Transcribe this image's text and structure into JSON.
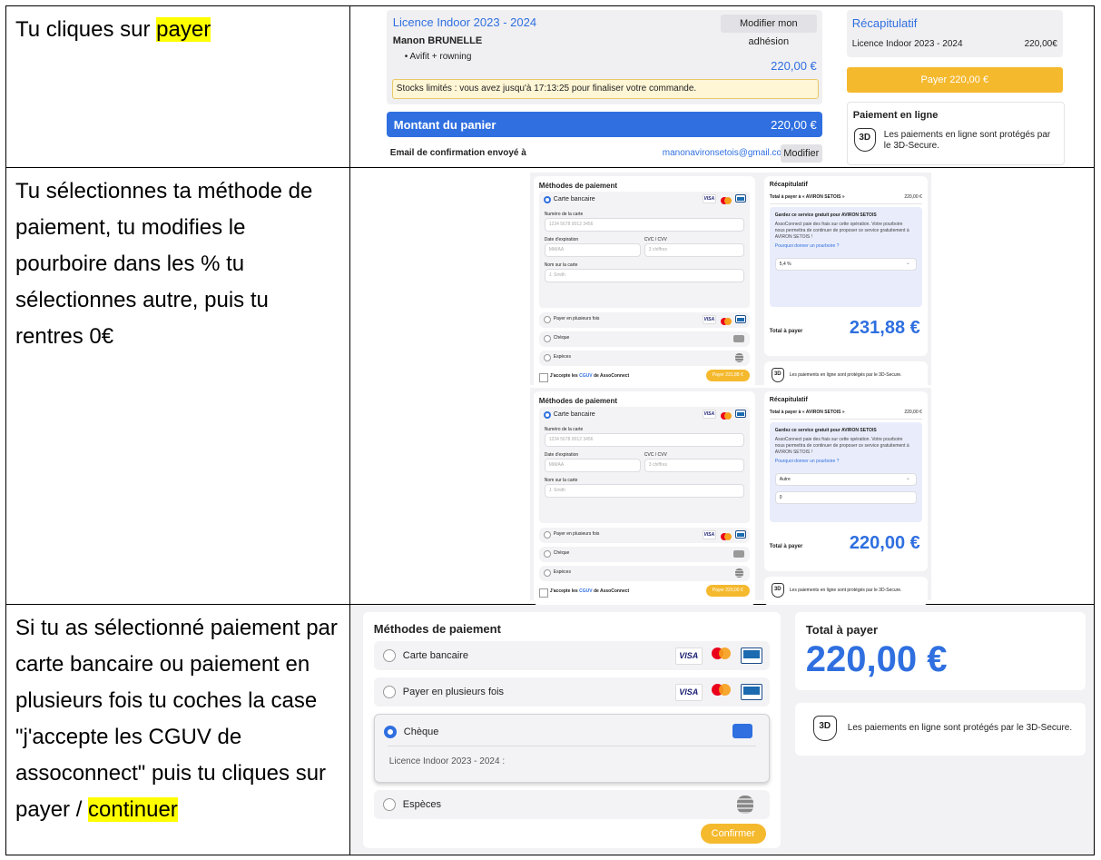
{
  "rows": [
    {
      "text_before": "Tu cliques sur ",
      "highlight": "payer",
      "text_after": ""
    },
    {
      "text_before": "Tu sélectionnes ta méthode de paiement, tu modifies le pourboire dans les % tu sélectionnes autre, puis tu rentres 0€",
      "highlight": "",
      "text_after": ""
    },
    {
      "text_before": "Si tu as sélectionné paiement par carte bancaire ou paiement en plusieurs fois tu coches la case \"j'accepte les CGUV de assoconnect\" puis tu cliques sur payer / ",
      "highlight": "continuer",
      "text_after": ""
    }
  ],
  "s1": {
    "licence_title": "Licence Indoor 2023 - 2024",
    "modify_membership": "Modifier mon adhésion",
    "member_name": "Manon BRUNELLE",
    "item": "Avifit + rowning",
    "item_price": "220,00 €",
    "stock_notice": "Stocks limités : vous avez jusqu'à 17:13:25 pour finaliser votre commande.",
    "cart_label": "Montant du panier",
    "cart_amount": "220,00 €",
    "email_label": "Email de confirmation envoyé à",
    "email": "manonavironsetois@gmail.com",
    "modify": "Modifier",
    "recap_title": "Récapitulatif",
    "recap_item": "Licence Indoor 2023 - 2024",
    "recap_price": "220,00€",
    "pay_button": "Payer 220,00 €",
    "online_title": "Paiement en ligne",
    "secure_text": "Les paiements en ligne sont protégés par le 3D-Secure.",
    "shield_label": "3D"
  },
  "s2": [
    {
      "methods_title": "Méthodes de paiement",
      "card_method": "Carte bancaire",
      "card_number_label": "Numéro de la carte",
      "card_number_ph": "1234 5678 9012 3456",
      "expiry_label": "Date d'expiration",
      "expiry_ph": "MM/AA",
      "cvc_label": "CVC / CVV",
      "cvc_ph": "3 chiffres",
      "name_label": "Nom sur la carte",
      "name_ph": "J. Smith",
      "installments": "Payer en plusieurs fois",
      "cheque": "Chèque",
      "cash": "Espèces",
      "cgu_prefix": "J'accepte les ",
      "cgu_link": "CGUV",
      "cgu_suffix": " de AssoConnect",
      "pay_button": "Payer 231,88 €",
      "recap_title": "Récapitulatif",
      "total_to": "Total à payer à « AVIRON SETOIS »",
      "total_to_amount": "220,00 €",
      "tip_title": "Gardez ce service gratuit pour AVIRON SETOIS",
      "tip_body": "AssoConnect paie des frais sur cette opération. Votre pourboire nous permettra de continuer de proposer ce service gratuitement à AVIRON SETOIS !",
      "tip_link": "Pourquoi donner un pourboire ?",
      "tip_select": "5,4 %",
      "tip_input": "",
      "total_label": "Total à payer",
      "total_amount": "231,88 €",
      "secure_text": "Les paiements en ligne sont protégés par le 3D-Secure.",
      "shield_label": "3D"
    },
    {
      "methods_title": "Méthodes de paiement",
      "card_method": "Carte bancaire",
      "card_number_label": "Numéro de la carte",
      "card_number_ph": "1234 5678 9012 3456",
      "expiry_label": "Date d'expiration",
      "expiry_ph": "MM/AA",
      "cvc_label": "CVC / CVV",
      "cvc_ph": "3 chiffres",
      "name_label": "Nom sur la carte",
      "name_ph": "J. Smith",
      "installments": "Payer en plusieurs fois",
      "cheque": "Chèque",
      "cash": "Espèces",
      "cgu_prefix": "J'accepte les ",
      "cgu_link": "CGUV",
      "cgu_suffix": " de AssoConnect",
      "pay_button": "Payer 220,00 €",
      "recap_title": "Récapitulatif",
      "total_to": "Total à payer à « AVIRON SETOIS »",
      "total_to_amount": "220,00 €",
      "tip_title": "Gardez ce service gratuit pour AVIRON SETOIS",
      "tip_body": "AssoConnect paie des frais sur cette opération. Votre pourboire nous permettra de continuer de proposer ce service gratuitement à AVIRON SETOIS !",
      "tip_link": "Pourquoi donner un pourboire ?",
      "tip_select": "Autre",
      "tip_input": "0",
      "total_label": "Total à payer",
      "total_amount": "220,00 €",
      "secure_text": "Les paiements en ligne sont protégés par le 3D-Secure.",
      "shield_label": "3D"
    }
  ],
  "s3": {
    "methods_title": "Méthodes de paiement",
    "card_method": "Carte bancaire",
    "installments": "Payer en plusieurs fois",
    "cheque": "Chèque",
    "cheque_detail": "Licence Indoor 2023 - 2024 :",
    "cash": "Espèces",
    "confirm": "Confirmer",
    "total_label": "Total à payer",
    "total_amount": "220,00 €",
    "secure_text": "Les paiements en ligne sont protégés par le 3D-Secure.",
    "shield_label": "3D"
  },
  "card_brand": "VISA",
  "icons": {
    "cheque": "cheque-icon",
    "cash": "coins-icon",
    "dropdown": "chevron-down-icon"
  },
  "colors": {
    "accent": "#2f6fe0",
    "button": "#f5b92e",
    "highlight": "#ffff00"
  }
}
